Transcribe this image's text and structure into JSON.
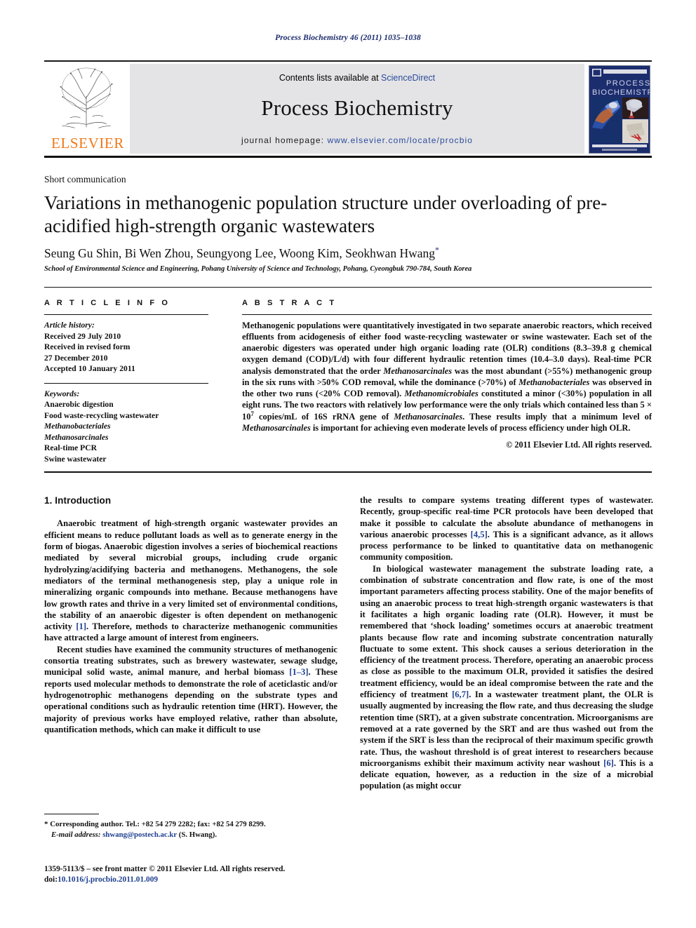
{
  "running_head": "Process Biochemistry 46 (2011) 1035–1038",
  "masthead": {
    "publisher_name": "ELSEVIER",
    "contents_prefix": "Contents lists available at ",
    "contents_link": "ScienceDirect",
    "journal_title": "Process Biochemistry",
    "homepage_label": "journal homepage: ",
    "homepage_url": "www.elsevier.com/locate/procbio",
    "cover_title_line1": "PROCESS",
    "cover_title_line2": "BIOCHEMISTRY",
    "accent_orange": "#f07818",
    "accent_blue": "#2a4b9b",
    "band_gray": "#e4e4e6",
    "cover_navy": "#1c2d6e"
  },
  "article": {
    "kind": "Short communication",
    "title": "Variations in methanogenic population structure under overloading of pre-acidified high-strength organic wastewaters",
    "authors": "Seung Gu Shin, Bi Wen Zhou, Seungyong Lee, Woong Kim, Seokhwan Hwang",
    "corresponding_marker": "*",
    "affiliation": "School of Environmental Science and Engineering, Pohang University of Science and Technology, Pohang, Cyeongbuk 790-784, South Korea"
  },
  "article_info": {
    "heading": "A R T I C L E    I N F O",
    "history_label": "Article history:",
    "history": [
      "Received 29 July 2010",
      "Received in revised form",
      "27 December 2010",
      "Accepted 10 January 2011"
    ],
    "keywords_label": "Keywords:",
    "keywords": [
      "Anaerobic digestion",
      "Food waste-recycling wastewater",
      "Methanobacteriales",
      "Methanosarcinales",
      "Real-time PCR",
      "Swine wastewater"
    ],
    "keywords_italic": [
      false,
      false,
      true,
      true,
      false,
      false
    ]
  },
  "abstract": {
    "heading": "A B S T R A C T",
    "paragraph_html": "Methanogenic populations were quantitatively investigated in two separate anaerobic reactors, which received effluents from acidogenesis of either food waste-recycling wastewater or swine wastewater. Each set of the anaerobic digesters was operated under high organic loading rate (OLR) conditions (8.3–39.8 g chemical oxygen demand (COD)/L/d) with four different hydraulic retention times (10.4–3.0 days). Real-time PCR analysis demonstrated that the order <i>Methanosarcinales</i> was the most abundant (>55%) methanogenic group in the six runs with >50% COD removal, while the dominance (>70%) of <i>Methanobacteriales</i> was observed in the other two runs (<20% COD removal). <i>Methanomicrobiales</i> constituted a minor (<30%) population in all eight runs. The two reactors with relatively low performance were the only trials which contained less than 5 × 10<sup>7</sup> copies/mL of 16S rRNA gene of <i>Methanosarcinales</i>. These results imply that a minimum level of <i>Methanosarcinales</i> is important for achieving even moderate levels of process efficiency under high OLR.",
    "copyright": "© 2011 Elsevier Ltd. All rights reserved."
  },
  "body": {
    "section_number_title": "1.  Introduction",
    "left_paragraphs_html": [
      "Anaerobic treatment of high-strength organic wastewater provides an efficient means to reduce pollutant loads as well as to generate energy in the form of biogas. Anaerobic digestion involves a series of biochemical reactions mediated by several microbial groups, including crude organic hydrolyzing/acidifying bacteria and methanogens. Methanogens, the sole mediators of the terminal methanogenesis step, play a unique role in mineralizing organic compounds into methane. Because methanogens have low growth rates and thrive in a very limited set of environmental conditions, the stability of an anaerobic digester is often dependent on methanogenic activity <span class=\"ref\">[1]</span>. Therefore, methods to characterize methanogenic communities have attracted a large amount of interest from engineers.",
      "Recent studies have examined the community structures of methanogenic consortia treating substrates, such as brewery wastewater, sewage sludge, municipal solid waste, animal manure, and herbal biomass <span class=\"ref\">[1–3]</span>. These reports used molecular methods to demonstrate the role of aceticlastic and/or hydrogenotrophic methanogens depending on the substrate types and operational conditions such as hydraulic retention time (HRT). However, the majority of previous works have employed relative, rather than absolute, quantification methods, which can make it difficult to use"
    ],
    "right_paragraphs_html": [
      "the results to compare systems treating different types of wastewater. Recently, group-specific real-time PCR protocols have been developed that make it possible to calculate the absolute abundance of methanogens in various anaerobic processes <span class=\"ref\">[4,5]</span>. This is a significant advance, as it allows process performance to be linked to quantitative data on methanogenic community composition.",
      "In biological wastewater management the substrate loading rate, a combination of substrate concentration and flow rate, is one of the most important parameters affecting process stability. One of the major benefits of using an anaerobic process to treat high-strength organic wastewaters is that it facilitates a high organic loading rate (OLR). However, it must be remembered that ‘shock loading’ sometimes occurs at anaerobic treatment plants because flow rate and incoming substrate concentration naturally fluctuate to some extent. This shock causes a serious deterioration in the efficiency of the treatment process. Therefore, operating an anaerobic process as close as possible to the maximum OLR, provided it satisfies the desired treatment efficiency, would be an ideal compromise between the rate and the efficiency of treatment <span class=\"ref\">[6,7]</span>. In a wastewater treatment plant, the OLR is usually augmented by increasing the flow rate, and thus decreasing the sludge retention time (SRT), at a given substrate concentration. Microorganisms are removed at a rate governed by the SRT and are thus washed out from the system if the SRT is less than the reciprocal of their maximum specific growth rate. Thus, the washout threshold is of great interest to researchers because microorganisms exhibit their maximum activity near washout <span class=\"ref\">[6]</span>. This is a delicate equation, however, as a reduction in the size of a microbial population (as might occur"
    ]
  },
  "footnote": {
    "marker": "*",
    "text_html": "Corresponding author. Tel.: +82 54 279 2282; fax: +82 54 279 8299.",
    "email_label": "E-mail address:",
    "email": "shwang@postech.ac.kr",
    "email_suffix": "(S. Hwang)."
  },
  "imprint": {
    "line1": "1359-5113/$ – see front matter © 2011 Elsevier Ltd. All rights reserved.",
    "doi_label": "doi:",
    "doi_value": "10.1016/j.procbio.2011.01.009"
  }
}
